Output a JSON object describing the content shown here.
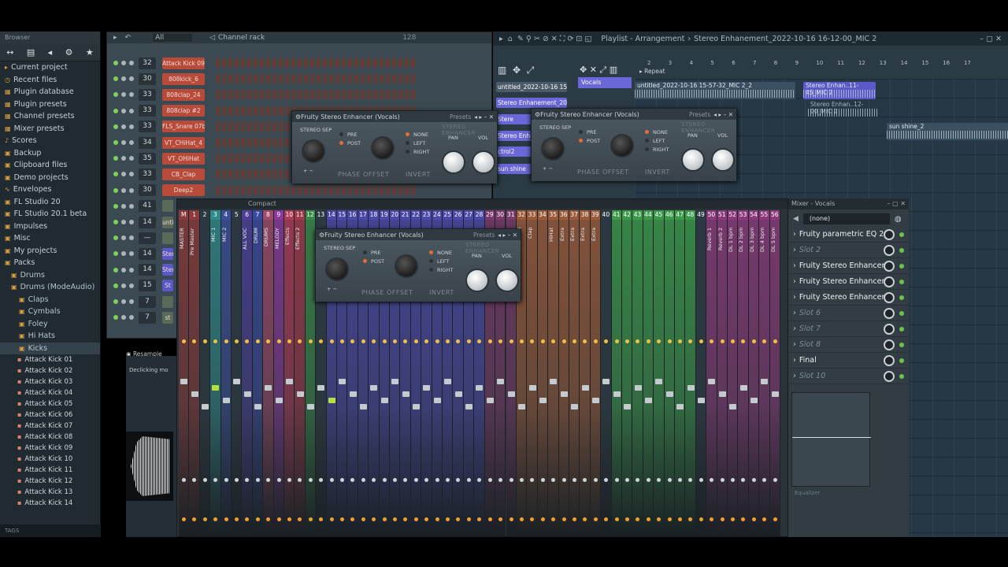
{
  "browser": {
    "title": "Browser",
    "items": [
      {
        "label": "Current project"
      },
      {
        "label": "Recent files"
      },
      {
        "label": "Plugin database"
      },
      {
        "label": "Plugin presets"
      },
      {
        "label": "Channel presets"
      },
      {
        "label": "Mixer presets"
      },
      {
        "label": "Scores"
      },
      {
        "label": "Backup"
      },
      {
        "label": "Clipboard files"
      },
      {
        "label": "Demo projects"
      },
      {
        "label": "Envelopes"
      },
      {
        "label": "FL Studio 20"
      },
      {
        "label": "FL Studio 20.1 beta"
      },
      {
        "label": "Impulses"
      },
      {
        "label": "Misc"
      },
      {
        "label": "My projects"
      },
      {
        "label": "Packs"
      }
    ],
    "packs": [
      {
        "label": "Drums"
      },
      {
        "label": "Drums (ModeAudio)"
      },
      {
        "label": "Claps"
      },
      {
        "label": "Cymbals"
      },
      {
        "label": "Foley"
      },
      {
        "label": "Hi Hats"
      },
      {
        "label": "Kicks"
      }
    ],
    "kicks": [
      "Attack Kick 01",
      "Attack Kick 02",
      "Attack Kick 03",
      "Attack Kick 04",
      "Attack Kick 05",
      "Attack Kick 06",
      "Attack Kick 07",
      "Attack Kick 08",
      "Attack Kick 09",
      "Attack Kick 10",
      "Attack Kick 11",
      "Attack Kick 12",
      "Attack Kick 13",
      "Attack Kick 14"
    ],
    "footer": "TAGS"
  },
  "channel_rack": {
    "title": "Channel rack",
    "filter": "All",
    "swing": "128",
    "channels": [
      {
        "num": "32",
        "name": "Attack Kick 09"
      },
      {
        "num": "30",
        "name": "808kick_6"
      },
      {
        "num": "33",
        "name": "808clap_24"
      },
      {
        "num": "33",
        "name": "808clap #2"
      },
      {
        "num": "33",
        "name": "FLS_Snare 07b"
      },
      {
        "num": "34",
        "name": "VT_CHiHat_4"
      },
      {
        "num": "35",
        "name": "VT_OHiHat"
      },
      {
        "num": "33",
        "name": "CB_Clap"
      },
      {
        "num": "30",
        "name": "Deep2"
      },
      {
        "num": "41",
        "name": ""
      },
      {
        "num": "14",
        "name": "unti"
      },
      {
        "num": "—",
        "name": ""
      },
      {
        "num": "14",
        "name": "Ster"
      },
      {
        "num": "14",
        "name": "Ster"
      },
      {
        "num": "15",
        "name": "St"
      },
      {
        "num": "7",
        "name": ""
      },
      {
        "num": "7",
        "name": "st"
      }
    ],
    "resample": "Resample",
    "declicking": "Declicking mo"
  },
  "playlist": {
    "title": "Playlist - Arrangement",
    "breadcrumb": "Stereo Enhanement_2022-10-16 16-12-00_MIC 2",
    "repeat": "Repeat",
    "ruler": [
      "2",
      "3",
      "4",
      "5",
      "6",
      "7",
      "8",
      "9",
      "10",
      "11",
      "12",
      "13",
      "14",
      "15",
      "16",
      "17"
    ],
    "patterns": [
      {
        "label": "untitled_2022-10-16 15-",
        "color": "#4a5a68"
      },
      {
        "label": "Stereo Enhanement_202",
        "color": "#6a68d8"
      },
      {
        "label": "Stere",
        "color": "#6a68d8"
      },
      {
        "label": "Stereo Enha",
        "color": "#6a68d8"
      },
      {
        "label": "ctrol2",
        "color": "#6a68d8"
      },
      {
        "label": "sun shine",
        "color": "#6a68d8"
      }
    ],
    "track_label": "Vocals",
    "clips": [
      {
        "label": "untitled_2022-10-16 15-57-32_MIC 2_2"
      },
      {
        "label": "Stereo Enhan..11-45_MIC 2"
      },
      {
        "label": "Stereo Enhan..12-00_MIC 2"
      },
      {
        "label": "sun shine_2"
      }
    ]
  },
  "plugins": [
    {
      "title": "Fruity Stereo Enhancer (Vocals)",
      "presets": "Presets",
      "brand": "STEREO ENHANCER",
      "stereo_sep": "STEREO SEP",
      "pre": "PRE",
      "post": "POST",
      "none": "NONE",
      "left": "LEFT",
      "right": "RIGHT",
      "pan": "PAN",
      "vol": "VOL",
      "phase_offset": "PHASE OFFSET",
      "invert": "INVERT"
    },
    {
      "title": "Fruity Stereo Enhancer (Vocals)",
      "presets": "Presets",
      "brand": "STEREO ENHANCER",
      "stereo_sep": "STEREO SEP",
      "pre": "PRE",
      "post": "POST",
      "none": "NONE",
      "left": "LEFT",
      "right": "RIGHT",
      "pan": "PAN",
      "vol": "VOL",
      "phase_offset": "PHASE OFFSET",
      "invert": "INVERT"
    },
    {
      "title": "Fruity Stereo Enhancer (Vocals)",
      "presets": "Presets",
      "brand": "STEREO ENHANCER",
      "stereo_sep": "STEREO SEP",
      "pre": "PRE",
      "post": "POST",
      "none": "NONE",
      "left": "LEFT",
      "right": "RIGHT",
      "pan": "PAN",
      "vol": "VOL",
      "phase_offset": "PHASE OFFSET",
      "invert": "INVERT"
    }
  ],
  "mixer": {
    "view": "Compact",
    "title": "Mixer - Vocals",
    "preset": "(none)",
    "tracks": [
      {
        "n": "M",
        "name": "MASTER",
        "color": "#8a3b3b"
      },
      {
        "n": "1",
        "name": "Pre Master",
        "color": "#8a3b3b"
      },
      {
        "n": "2",
        "name": "",
        "color": "#2c3a44"
      },
      {
        "n": "3",
        "name": "MIC 1",
        "color": "#2f8a8a"
      },
      {
        "n": "4",
        "name": "MIC 2",
        "color": "#3b4f9a"
      },
      {
        "n": "5",
        "name": "",
        "color": "#2c3a44"
      },
      {
        "n": "6",
        "name": "ALL VOC",
        "color": "#4b3f9a"
      },
      {
        "n": "7",
        "name": "DRUM",
        "color": "#3a4aa0"
      },
      {
        "n": "8",
        "name": "DRUMS",
        "color": "#a04a6a"
      },
      {
        "n": "9",
        "name": "MELODY",
        "color": "#8a3a9a"
      },
      {
        "n": "10",
        "name": "Effects",
        "color": "#b03a5a"
      },
      {
        "n": "11",
        "name": "Effects 2",
        "color": "#a03a4a"
      },
      {
        "n": "12",
        "name": "",
        "color": "#3a8a4a"
      },
      {
        "n": "13",
        "name": "",
        "color": "#2c3a44"
      },
      {
        "n": "14",
        "name": "",
        "color": "#4a48a8"
      },
      {
        "n": "15",
        "name": "",
        "color": "#4a48a8"
      },
      {
        "n": "16",
        "name": "",
        "color": "#4a48a8"
      },
      {
        "n": "17",
        "name": "",
        "color": "#4a48a8"
      },
      {
        "n": "18",
        "name": "",
        "color": "#4a48a8"
      },
      {
        "n": "19",
        "name": "",
        "color": "#4a48a8"
      },
      {
        "n": "20",
        "name": "",
        "color": "#4a48a8"
      },
      {
        "n": "21",
        "name": "",
        "color": "#4a48a8"
      },
      {
        "n": "22",
        "name": "",
        "color": "#4a48a8"
      },
      {
        "n": "23",
        "name": "",
        "color": "#4a48a8"
      },
      {
        "n": "24",
        "name": "",
        "color": "#4a48a8"
      },
      {
        "n": "25",
        "name": "",
        "color": "#4a48a8"
      },
      {
        "n": "26",
        "name": "",
        "color": "#4a48a8"
      },
      {
        "n": "27",
        "name": "",
        "color": "#4a48a8"
      },
      {
        "n": "28",
        "name": "",
        "color": "#4a48a8"
      },
      {
        "n": "29",
        "name": "",
        "color": "#7a3a6a"
      },
      {
        "n": "30",
        "name": "",
        "color": "#7a3a6a"
      },
      {
        "n": "31",
        "name": "",
        "color": "#7a3a6a"
      },
      {
        "n": "32",
        "name": "Chord",
        "color": "#9a5a3a"
      },
      {
        "n": "33",
        "name": "Clap",
        "color": "#9a5a3a"
      },
      {
        "n": "34",
        "name": "",
        "color": "#9a5a3a"
      },
      {
        "n": "35",
        "name": "HiHat",
        "color": "#9a5a3a"
      },
      {
        "n": "36",
        "name": "Extra",
        "color": "#9a5a3a"
      },
      {
        "n": "37",
        "name": "Extra",
        "color": "#9a5a3a"
      },
      {
        "n": "38",
        "name": "Extra",
        "color": "#9a5a3a"
      },
      {
        "n": "39",
        "name": "Extra",
        "color": "#9a5a3a"
      },
      {
        "n": "40",
        "name": "",
        "color": "#2c3a44"
      },
      {
        "n": "41",
        "name": "",
        "color": "#3a9a4a"
      },
      {
        "n": "42",
        "name": "",
        "color": "#3a9a4a"
      },
      {
        "n": "43",
        "name": "",
        "color": "#3a9a4a"
      },
      {
        "n": "44",
        "name": "",
        "color": "#3a9a4a"
      },
      {
        "n": "45",
        "name": "",
        "color": "#3a9a4a"
      },
      {
        "n": "46",
        "name": "",
        "color": "#3a9a4a"
      },
      {
        "n": "47",
        "name": "",
        "color": "#3a9a4a"
      },
      {
        "n": "48",
        "name": "",
        "color": "#3a9a4a"
      },
      {
        "n": "49",
        "name": "",
        "color": "#2c3a44"
      },
      {
        "n": "50",
        "name": "Reverb 1",
        "color": "#8a3a7a"
      },
      {
        "n": "51",
        "name": "Reverb 2",
        "color": "#8a3a7a"
      },
      {
        "n": "52",
        "name": "DL 1 bpm",
        "color": "#8a3a7a"
      },
      {
        "n": "53",
        "name": "DL 2 bpm",
        "color": "#8a3a7a"
      },
      {
        "n": "54",
        "name": "DL 3 bpm",
        "color": "#8a3a7a"
      },
      {
        "n": "55",
        "name": "DL 4 bpm",
        "color": "#8a3a7a"
      },
      {
        "n": "56",
        "name": "DL 5 bpm",
        "color": "#8a3a7a"
      }
    ],
    "slots": [
      {
        "label": "Fruity parametric EQ 2",
        "empty": false
      },
      {
        "label": "Slot 2",
        "empty": true
      },
      {
        "label": "Fruity Stereo Enhancer",
        "empty": false
      },
      {
        "label": "Fruity Stereo Enhancer",
        "empty": false
      },
      {
        "label": "Fruity Stereo Enhancer",
        "empty": false
      },
      {
        "label": "Slot 6",
        "empty": true
      },
      {
        "label": "Slot 7",
        "empty": true
      },
      {
        "label": "Slot 8",
        "empty": true
      },
      {
        "label": "Final",
        "empty": false
      },
      {
        "label": "Slot 10",
        "empty": true
      }
    ],
    "equalizer": "Equalizer"
  }
}
